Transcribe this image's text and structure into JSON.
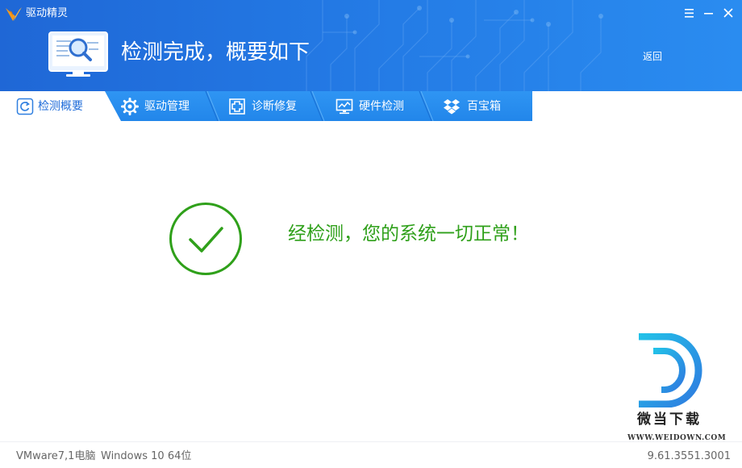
{
  "app": {
    "name": "驱动精灵"
  },
  "header": {
    "status_title": "检测完成，概要如下",
    "back_label": "返回"
  },
  "window_buttons": [
    "menu-icon",
    "minimize-icon",
    "close-icon"
  ],
  "tabs": [
    {
      "label": "检测概要",
      "icon": "refresh-icon",
      "active": true
    },
    {
      "label": "驱动管理",
      "icon": "gear-icon",
      "active": false
    },
    {
      "label": "诊断修复",
      "icon": "repair-icon",
      "active": false
    },
    {
      "label": "硬件检测",
      "icon": "monitor-chart-icon",
      "active": false
    },
    {
      "label": "百宝箱",
      "icon": "toolbox-icon",
      "active": false
    }
  ],
  "main": {
    "result_text": "经检测，您的系统一切正常！",
    "result_icon": "check-circle-icon"
  },
  "watermark": {
    "name": "微当下载",
    "url": "WWW.WEIDOWN.COM"
  },
  "footer": {
    "machine": "VMware7,1电脑",
    "os": "Windows 10 64位",
    "version": "9.61.3551.3001"
  },
  "colors": {
    "header_blue": "#1f67d6",
    "tab_blue": "#2b8ef0",
    "success_green": "#2fa01a",
    "accent_orange": "#f39a1e"
  }
}
